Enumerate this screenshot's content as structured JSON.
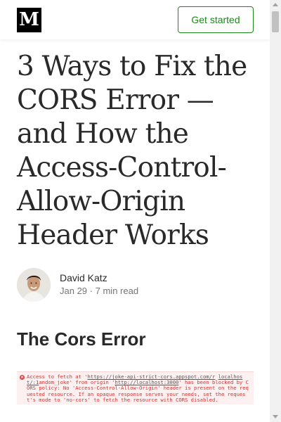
{
  "header": {
    "logo_text": "M",
    "cta_label": "Get started"
  },
  "article": {
    "title": "3 Ways to Fix the CORS Error — and How the Access-Control-Allow-Origin Header Works",
    "author": "David Katz",
    "date": "Jan 29",
    "separator": "·",
    "read_time": "7 min read",
    "section_heading": "The Cors Error"
  },
  "console_error": {
    "part1": "Access to fetch at '",
    "link1": "https://joke-api-strict-cors.appspot.com/r",
    "part2": " ",
    "link_right": "localhost/:1",
    "part3": "andom_joke' from origin '",
    "link2": "http://localhost:3000",
    "part4": "' has been blocked by CORS policy: No 'Access-Control-Allow-Origin' header is present on the requested resource. If an opaque response serves your needs, set the request's mode to 'no-cors' to fetch the resource with CORS disabled."
  },
  "colors": {
    "brand_green": "#1a8917",
    "error_red": "#d73131"
  }
}
